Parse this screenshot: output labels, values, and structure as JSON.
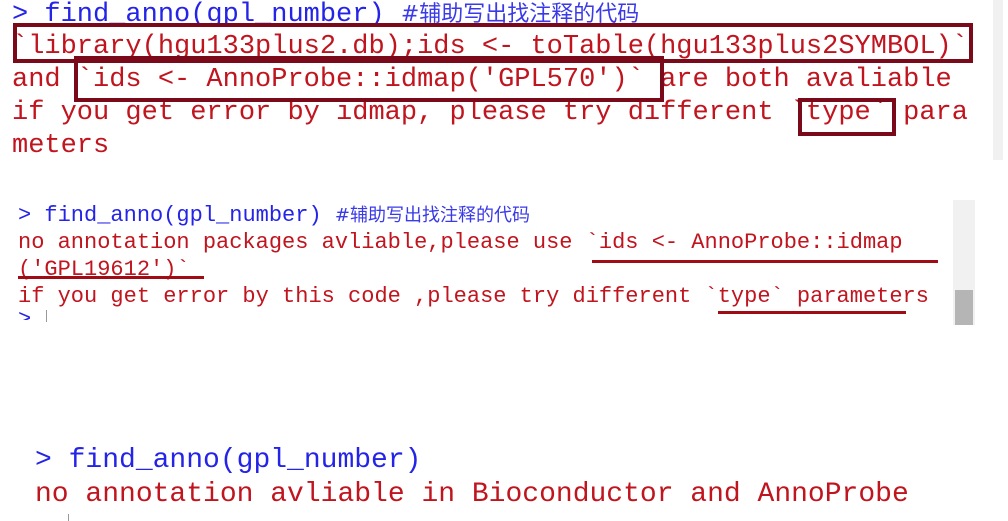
{
  "block1": {
    "prompt": "> ",
    "command": "find_anno(gpl_number) ",
    "comment": "#辅助写出找注释的代码",
    "lines": [
      "`library(hgu133plus2.db);ids <- toTable(hgu133plus2SYMBOL)`",
      "and `ids <- AnnoProbe::idmap('GPL570')` are both avaliable",
      "if you get error by idmap, please try different `type` para",
      "meters"
    ]
  },
  "block2": {
    "prompt": "> ",
    "command": "find_anno(gpl_number) ",
    "comment": "#辅助写出找注释的代码",
    "lines": [
      "no annotation packages avliable,please use `ids <- AnnoProbe::idmap",
      "('GPL19612')`",
      "if you get error by this code ,please try different `type` parameters"
    ],
    "next_prompt": ">"
  },
  "block3": {
    "prompt": "> ",
    "command": "find_anno(gpl_number)",
    "lines": [
      "no annotation avliable in Bioconductor and AnnoProbe"
    ]
  },
  "colors": {
    "prompt": "#2424e8",
    "output": "#c0141e",
    "highlight": "#7a0a1a"
  }
}
